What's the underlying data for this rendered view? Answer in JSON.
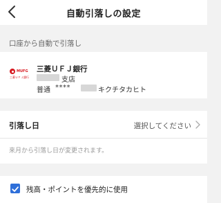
{
  "header": {
    "title": "自動引落しの設定",
    "back_icon": "chevron-left-icon"
  },
  "section": {
    "label": "口座から自動で引落し"
  },
  "bank": {
    "logo_text": "MUFG",
    "logo_subtext": "三菱ＵＦＪ銀行",
    "name": "三菱ＵＦＪ銀行",
    "branch_suffix": "支店",
    "account_type": "普通",
    "account_mask": "****",
    "account_holder": "キクチタカヒト"
  },
  "debit_date": {
    "label": "引落し日",
    "value": "選択してください",
    "chevron_icon": "chevron-right-icon",
    "note": "来月から引落し日が変更されます。"
  },
  "priority": {
    "checked": true,
    "label": "残高・ポイントを優先的に使用",
    "checkbox_color": "#2e6fd9"
  },
  "colors": {
    "brand_red": "#d71920",
    "accent_blue": "#2e6fd9",
    "background": "#f2f2f2"
  }
}
